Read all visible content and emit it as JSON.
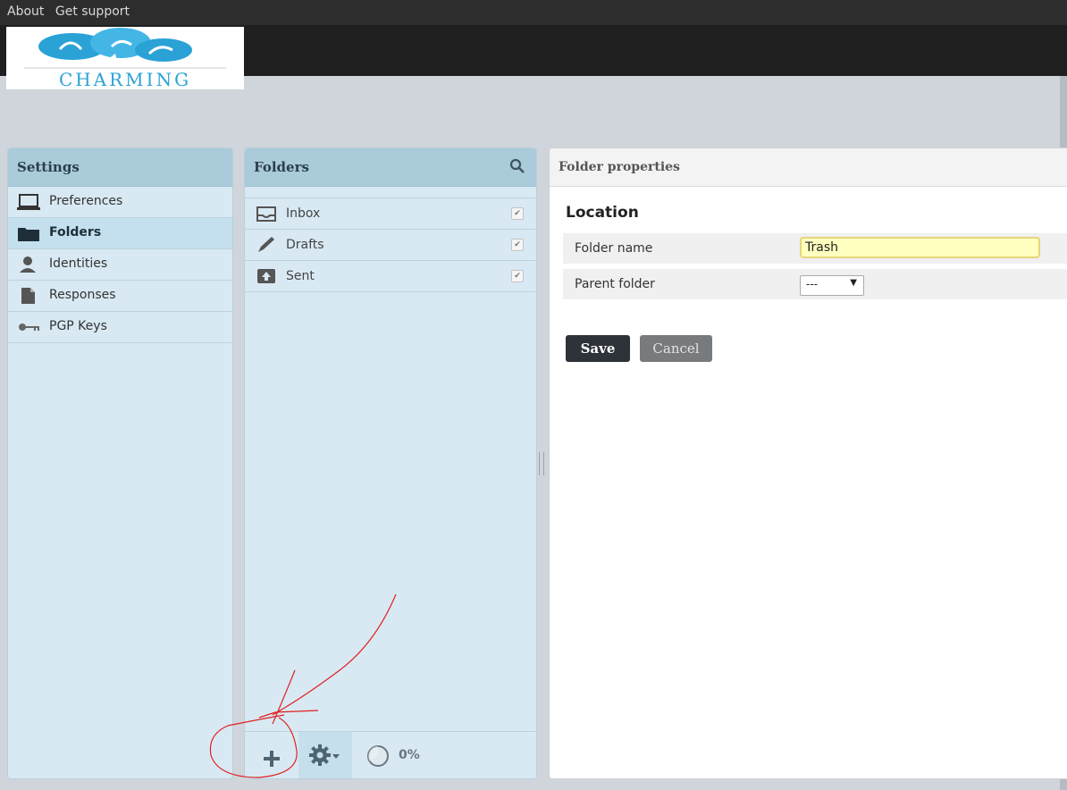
{
  "topbar": {
    "about": "About",
    "support": "Get support"
  },
  "logo": {
    "text": "CHARMING",
    "colors": [
      "#2aa2d6",
      "#5fc3ec"
    ]
  },
  "settings": {
    "title": "Settings",
    "items": [
      {
        "label": "Preferences",
        "icon": "laptop-icon"
      },
      {
        "label": "Folders",
        "icon": "folder-icon",
        "selected": true
      },
      {
        "label": "Identities",
        "icon": "user-icon"
      },
      {
        "label": "Responses",
        "icon": "document-icon"
      },
      {
        "label": "PGP Keys",
        "icon": "key-icon"
      }
    ]
  },
  "folders": {
    "title": "Folders",
    "search_icon": "search-icon",
    "items": [
      {
        "label": "Inbox",
        "icon": "inbox-icon",
        "subscribed": true
      },
      {
        "label": "Drafts",
        "icon": "pencil-icon",
        "subscribed": true
      },
      {
        "label": "Sent",
        "icon": "sent-icon",
        "subscribed": true
      }
    ],
    "footer": {
      "add_icon": "plus-icon",
      "options_icon": "gear-icon",
      "quota": 0,
      "quota_text": "0%"
    }
  },
  "properties": {
    "title": "Folder properties",
    "section": "Location",
    "folder_name_label": "Folder name",
    "folder_name_value": "Trash",
    "parent_folder_label": "Parent folder",
    "parent_folder_value": "---",
    "save_label": "Save",
    "cancel_label": "Cancel"
  },
  "colors": {
    "accent": "#a9cbda",
    "panel": "#d8e9f3",
    "selected": "#c4e0ee",
    "annotation": "#e02020"
  }
}
